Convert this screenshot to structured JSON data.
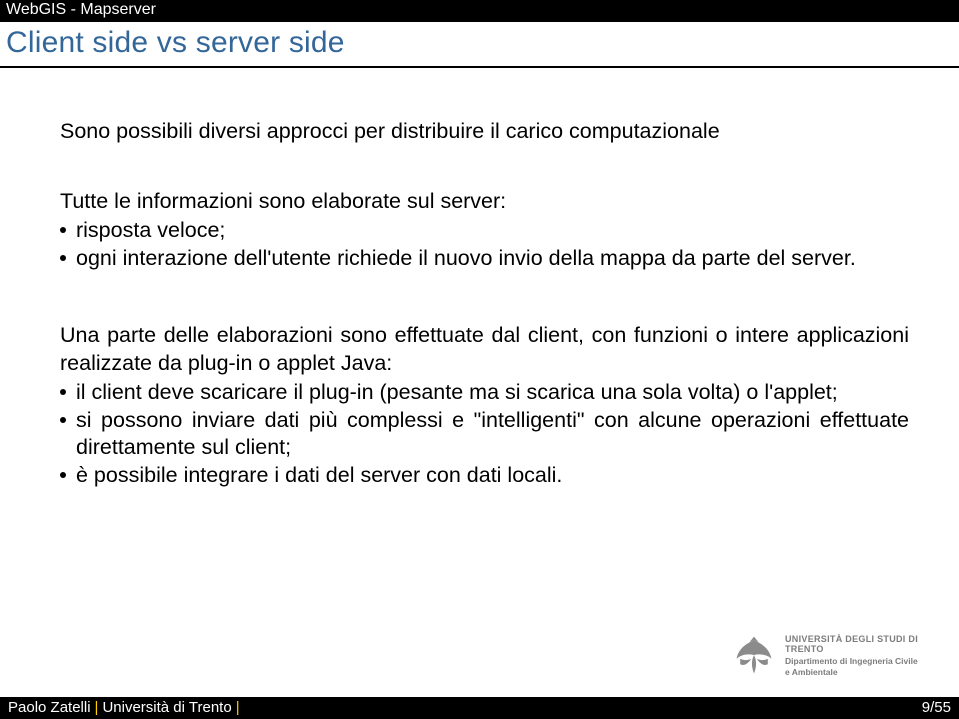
{
  "header": {
    "topbar": "WebGIS - Mapserver",
    "title": "Client side vs server side"
  },
  "content": {
    "intro": "Sono possibili diversi approcci per distribuire il carico computazionale",
    "server_section": {
      "label": "Tutte le informazioni sono elaborate sul server:",
      "bullets": [
        "risposta veloce;",
        "ogni interazione dell'utente richiede il nuovo invio della mappa da parte del server."
      ]
    },
    "client_section": {
      "label": "Una parte delle elaborazioni sono effettuate dal client, con funzioni o intere applicazioni realizzate da plug-in o applet Java:",
      "bullets": [
        "il client deve scaricare il plug-in (pesante ma si scarica una sola volta) o l'applet;",
        "si possono inviare dati più complessi e \"intelligenti\" con alcune operazioni effettuate direttamente sul client;",
        "è possibile integrare i dati del server con dati locali."
      ]
    }
  },
  "logo": {
    "university": "UNIVERSITÀ DEGLI STUDI DI TRENTO",
    "department1": "Dipartimento di Ingegneria Civile",
    "department2": "e Ambientale"
  },
  "footer": {
    "author": "Paolo Zatelli",
    "affiliation": "Università di Trento",
    "separator": "|",
    "page": "9/55"
  }
}
